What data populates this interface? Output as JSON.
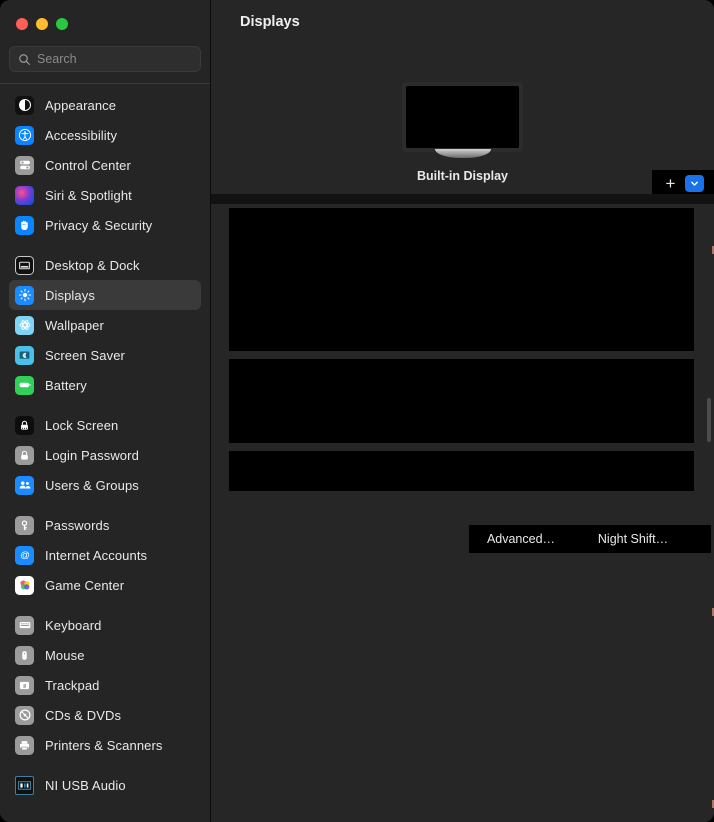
{
  "window": {
    "traffic_lights": [
      {
        "name": "close",
        "color": "#ff5f57"
      },
      {
        "name": "minimize",
        "color": "#febc2e"
      },
      {
        "name": "zoom",
        "color": "#28c840"
      }
    ]
  },
  "search": {
    "placeholder": "Search",
    "value": "",
    "icon": "search-icon"
  },
  "sidebar": {
    "groups": [
      {
        "items": [
          {
            "label": "Appearance",
            "icon": "appearance-icon",
            "selected": false
          },
          {
            "label": "Accessibility",
            "icon": "accessibility-icon",
            "selected": false
          },
          {
            "label": "Control Center",
            "icon": "control-center-icon",
            "selected": false
          },
          {
            "label": "Siri & Spotlight",
            "icon": "siri-icon",
            "selected": false
          },
          {
            "label": "Privacy & Security",
            "icon": "privacy-security-icon",
            "selected": false
          }
        ]
      },
      {
        "items": [
          {
            "label": "Desktop & Dock",
            "icon": "desktop-dock-icon",
            "selected": false
          },
          {
            "label": "Displays",
            "icon": "displays-icon",
            "selected": true
          },
          {
            "label": "Wallpaper",
            "icon": "wallpaper-icon",
            "selected": false
          },
          {
            "label": "Screen Saver",
            "icon": "screen-saver-icon",
            "selected": false
          },
          {
            "label": "Battery",
            "icon": "battery-icon",
            "selected": false
          }
        ]
      },
      {
        "items": [
          {
            "label": "Lock Screen",
            "icon": "lock-screen-icon",
            "selected": false
          },
          {
            "label": "Login Password",
            "icon": "login-password-icon",
            "selected": false
          },
          {
            "label": "Users & Groups",
            "icon": "users-groups-icon",
            "selected": false
          }
        ]
      },
      {
        "items": [
          {
            "label": "Passwords",
            "icon": "passwords-icon",
            "selected": false
          },
          {
            "label": "Internet Accounts",
            "icon": "internet-accounts-icon",
            "selected": false
          },
          {
            "label": "Game Center",
            "icon": "game-center-icon",
            "selected": false
          }
        ]
      },
      {
        "items": [
          {
            "label": "Keyboard",
            "icon": "keyboard-icon",
            "selected": false
          },
          {
            "label": "Mouse",
            "icon": "mouse-icon",
            "selected": false
          },
          {
            "label": "Trackpad",
            "icon": "trackpad-icon",
            "selected": false
          },
          {
            "label": "CDs & DVDs",
            "icon": "cds-dvds-icon",
            "selected": false
          },
          {
            "label": "Printers & Scanners",
            "icon": "printers-icon",
            "selected": false
          }
        ]
      },
      {
        "items": [
          {
            "label": "NI USB Audio",
            "icon": "ni-usb-audio-icon",
            "selected": false
          }
        ]
      }
    ]
  },
  "main": {
    "title": "Displays",
    "display": {
      "name": "Built-in Display"
    },
    "add_bar": {
      "add_label": "+",
      "chevron_icon": "chevron-down-icon"
    },
    "buttons": {
      "advanced": "Advanced…",
      "night_shift": "Night Shift…"
    }
  },
  "colors": {
    "accent": "#1b72e8",
    "window_bg": "#262626",
    "sidebar_bg": "#252525",
    "selected_bg": "#3a3a3a",
    "redacted": "#000000"
  }
}
